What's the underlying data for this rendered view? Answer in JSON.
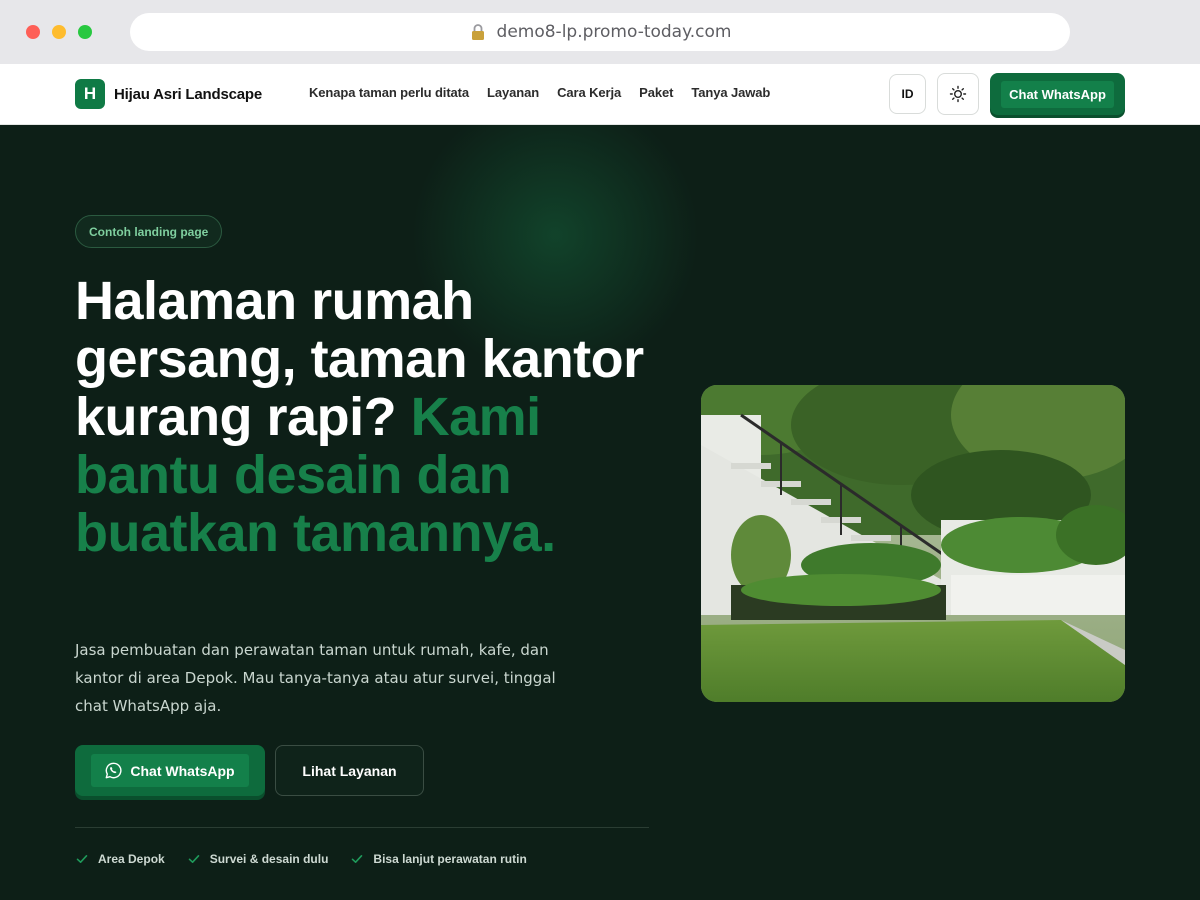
{
  "browser": {
    "url": "demo8-lp.promo-today.com"
  },
  "header": {
    "brand_initial": "H",
    "brand_name": "Hijau Asri Landscape",
    "nav": [
      {
        "label": "Kenapa taman perlu ditata"
      },
      {
        "label": "Layanan"
      },
      {
        "label": "Cara Kerja"
      },
      {
        "label": "Paket"
      },
      {
        "label": "Tanya Jawab"
      }
    ],
    "lang_label": "ID",
    "whatsapp_label": "Chat WhatsApp"
  },
  "hero": {
    "pill": "Contoh landing page",
    "headline_main": "Halaman rumah gersang, taman kantor kurang rapi?",
    "headline_accent": "Kami bantu desain dan buatkan tamannya.",
    "subtitle": "Jasa pembuatan dan perawatan taman untuk rumah, kafe, dan kantor di area Depok. Mau tanya-tanya atau atur survei, tinggal chat WhatsApp aja.",
    "cta_primary": "Chat WhatsApp",
    "cta_secondary": "Lihat Layanan",
    "features": [
      {
        "label": "Area Depok"
      },
      {
        "label": "Survei & desain dulu"
      },
      {
        "label": "Bisa lanjut perawatan rutin"
      }
    ]
  },
  "colors": {
    "brand_green": "#0f7a45",
    "hero_bg": "#0d1f17",
    "accent_text": "#17804a"
  }
}
